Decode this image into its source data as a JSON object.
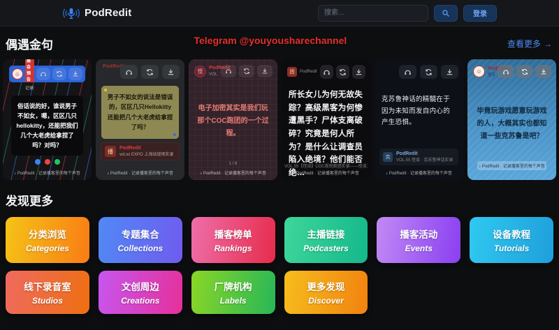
{
  "header": {
    "brand": "PodRedit",
    "search_placeholder": "搜索...",
    "login_label": "登录"
  },
  "watermark": "Telegram @youyousharechannel",
  "quotes": {
    "title": "偶遇金句",
    "view_more": "查看更多",
    "arrow": "→",
    "cards": [
      {
        "name": "展会预告",
        "sub": "记录播客的每个声音",
        "quote": "俗话说的好，谁说男子不如女，嗯，区区几只hellokitty，还能把我们几个大老虎给拿捏了吗？对吗？",
        "footer": "♪ PodRedit · 记录播客里的每个声音"
      },
      {
        "badge": "PodRedit",
        "quote": "男子不如女的说法是错误的，区区几只Hellokitty还能把几个大老虎给拿捏了吗？",
        "name": "PodRedit",
        "sub": "vol.xx EXPO 上海站现场实录",
        "footer": "♪ PodRedit · 记录播客里的每个声音"
      },
      {
        "name": "PodRedit",
        "sub": "VOL.55 · 怪谈工坊",
        "quote": "电子加密其实是我们玩那个COC跑团的一个过程。",
        "meta": "1 / 8",
        "footer": "♪ PodRedit · 记录播客里的每个声音"
      },
      {
        "name": "PodRedit",
        "quote": "所长女儿为何无故失踪？高级黑客为何惨遭黑手？尸体支离破碎？究竟是何人所为？是什么让调查员陷入绝境？他们能否绝…",
        "meta": "VOL.55【怪谈】COC规则跑团实录——怪谈工坊第四部曲（上）",
        "footer": "♪ PodRedit · 记录播客里的每个声音"
      },
      {
        "quote": "克苏鲁神话的精髓在于因为未知而发自内心的产生恐惧。",
        "name": "PodRedit",
        "sub": "VOL.55 怪谈 · 克苏鲁神话实录",
        "footer": "♪ PodRedit · 记录播客里的每个声音"
      },
      {
        "name": "PodRedit",
        "sub": "怪谈 · 第四期",
        "quote": "毕竟玩游戏愿意玩游戏的人，大概其实也都知道一些克苏鲁是吧？",
        "footer": "♪ PodRedit · 记录播客里的每个声音"
      }
    ],
    "dot_colors": [
      "#3b82f6",
      "#ef4444",
      "#22c55e"
    ]
  },
  "discover": {
    "title": "发现更多",
    "buttons": [
      {
        "zh": "分类浏览",
        "en": "Categories",
        "g1": "#f6c316",
        "g2": "#f87c15"
      },
      {
        "zh": "专题集合",
        "en": "Collections",
        "g1": "#5089f5",
        "g2": "#705bef"
      },
      {
        "zh": "播客榜单",
        "en": "Rankings",
        "g1": "#ee6fa9",
        "g2": "#e72b4c"
      },
      {
        "zh": "主播链接",
        "en": "Podcasters",
        "g1": "#3ed69b",
        "g2": "#14b88b"
      },
      {
        "zh": "播客活动",
        "en": "Events",
        "g1": "#c18af5",
        "g2": "#8a3ff0"
      },
      {
        "zh": "设备教程",
        "en": "Tutorials",
        "g1": "#2fc9f0",
        "g2": "#1f9fdb"
      },
      {
        "zh": "线下录音室",
        "en": "Studios",
        "g1": "#ef6a5e",
        "g2": "#ee6f12"
      },
      {
        "zh": "文创周边",
        "en": "Creations",
        "g1": "#c756ef",
        "g2": "#e5309a"
      },
      {
        "zh": "厂牌机构",
        "en": "Labels",
        "g1": "#8bd626",
        "g2": "#27b757"
      },
      {
        "zh": "更多发现",
        "en": "Discover",
        "g1": "#f6bd1d",
        "g2": "#f1820f"
      }
    ]
  }
}
